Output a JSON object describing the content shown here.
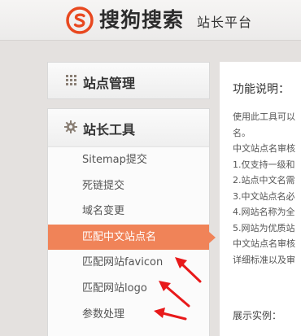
{
  "header": {
    "brand": "搜狗搜索",
    "subtitle": "站长平台",
    "logo_icon": "sogou-s-logo",
    "accent": "#e8481f"
  },
  "sidebar": {
    "panel_site": {
      "title": "站点管理",
      "icon": "grid-icon"
    },
    "panel_tools": {
      "title": "站长工具",
      "icon": "gear-icon",
      "items": [
        {
          "label": "Sitemap提交",
          "active": false
        },
        {
          "label": "死链提交",
          "active": false
        },
        {
          "label": "域名变更",
          "active": false
        },
        {
          "label": "匹配中文站点名",
          "active": true
        },
        {
          "label": "匹配网站favicon",
          "active": false
        },
        {
          "label": "匹配网站logo",
          "active": false
        },
        {
          "label": "参数处理",
          "active": false
        }
      ],
      "active_color": "#f08358"
    }
  },
  "content": {
    "heading": "功能说明：",
    "lines": [
      "使用此工具可以",
      "名。",
      "中文站点名审核",
      "1.仅支持一级和",
      "2.站点中文名需",
      "3.中文站点名必",
      "4.网站名称为全",
      "5.网站为优质站",
      "中文站点名审核",
      "详细标准以及审"
    ],
    "example_label": "展示实例："
  },
  "annotations": {
    "arrow_color": "#e8191a"
  }
}
